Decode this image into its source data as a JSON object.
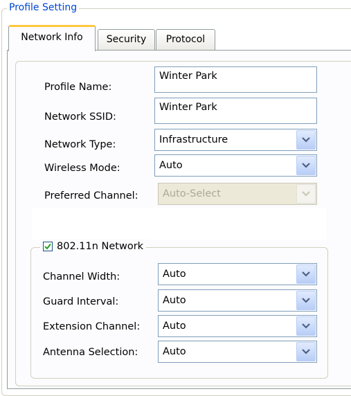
{
  "group": {
    "title": "Profile Setting"
  },
  "tabs": [
    {
      "label": "Network Info",
      "active": true
    },
    {
      "label": "Security",
      "active": false
    },
    {
      "label": "Protocol",
      "active": false
    }
  ],
  "fields": {
    "profile_name": {
      "label": "Profile Name:",
      "value": "Winter Park"
    },
    "network_ssid": {
      "label": "Network SSID:",
      "value": "Winter Park"
    },
    "network_type": {
      "label": "Network Type:",
      "value": "Infrastructure"
    },
    "wireless_mode": {
      "label": "Wireless Mode:",
      "value": "Auto"
    },
    "preferred_channel": {
      "label": "Preferred Channel:",
      "value": "Auto-Select",
      "disabled": true
    }
  },
  "n_network": {
    "label": "802.11n Network",
    "checked": true,
    "channel_width": {
      "label": "Channel Width:",
      "value": "Auto"
    },
    "guard_interval": {
      "label": "Guard Interval:",
      "value": "Auto"
    },
    "extension_channel": {
      "label": "Extension Channel:",
      "value": "Auto"
    },
    "antenna_selection": {
      "label": "Antenna Selection:",
      "value": "Auto"
    }
  },
  "icons": {
    "dropdown": "chevron-down-icon",
    "check": "checkmark-icon"
  },
  "colors": {
    "title": "#0046d5",
    "tab_highlight": "#ffc83c",
    "field_border": "#7f9db9",
    "disabled_bg": "#ece9d8"
  }
}
